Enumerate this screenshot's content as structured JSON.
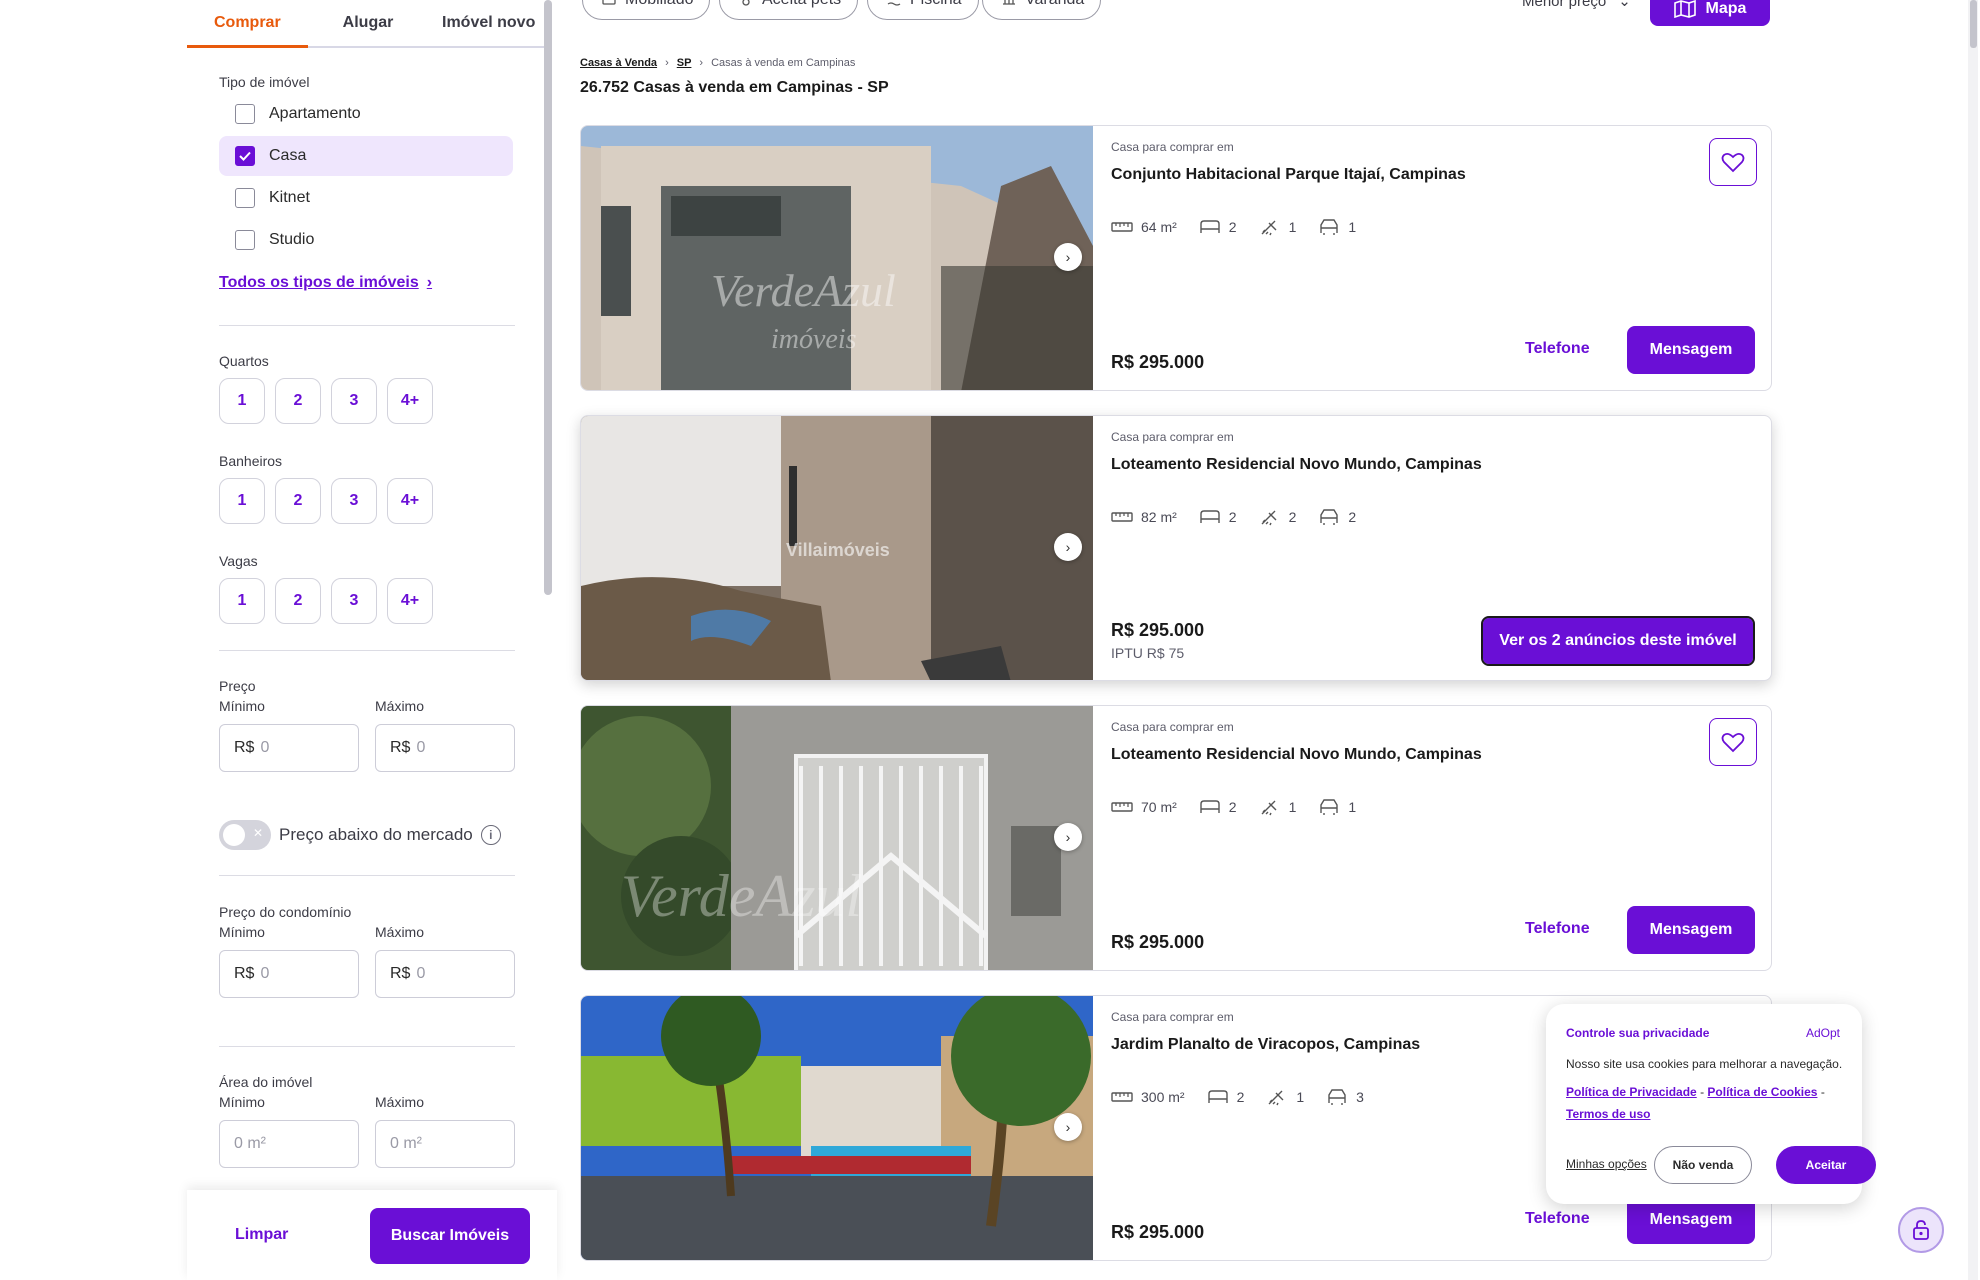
{
  "sidebar": {
    "tabs": [
      "Comprar",
      "Alugar",
      "Imóvel novo"
    ],
    "tipo_label": "Tipo de imóvel",
    "tipos": [
      "Apartamento",
      "Casa",
      "Kitnet",
      "Studio"
    ],
    "todos_link": "Todos os tipos de imóveis",
    "quartos_label": "Quartos",
    "banheiros_label": "Banheiros",
    "vagas_label": "Vagas",
    "options": [
      "1",
      "2",
      "3",
      "4+"
    ],
    "preco_label": "Preço",
    "minimo": "Mínimo",
    "maximo": "Máximo",
    "currency": "R$",
    "zero": "0",
    "area_zero": "0 m²",
    "abaixo_label": "Preço abaixo do mercado",
    "condominio_label": "Preço do condomínio",
    "area_label": "Área do imóvel",
    "limpar": "Limpar",
    "buscar": "Buscar Imóveis"
  },
  "toolbar": {
    "chips": [
      "Mobiliado",
      "Aceita pets",
      "Piscina",
      "Varanda"
    ],
    "sort": "Menor preço",
    "mapa": "Mapa"
  },
  "breadcrumb": [
    "Casas à Venda",
    "SP",
    "Casas à venda em Campinas"
  ],
  "results_title": "26.752 Casas à venda em Campinas - SP",
  "cards": [
    {
      "type": "Casa para comprar em",
      "address": "Conjunto Habitacional Parque Itajaí, Campinas",
      "area": "64 m²",
      "quartos": "2",
      "banheiros": "1",
      "vagas": "1",
      "price": "R$ 295.000",
      "telefone": "Telefone",
      "mensagem": "Mensagem",
      "watermark": "VerdeAzul Imóveis"
    },
    {
      "type": "Casa para comprar em",
      "address": "Loteamento Residencial Novo Mundo, Campinas",
      "area": "82 m²",
      "quartos": "2",
      "banheiros": "2",
      "vagas": "2",
      "price": "R$ 295.000",
      "iptu": "IPTU R$ 75",
      "ver": "Ver os 2 anúncios deste imóvel",
      "watermark": "Villaimóveis"
    },
    {
      "type": "Casa para comprar em",
      "address": "Loteamento Residencial Novo Mundo, Campinas",
      "area": "70 m²",
      "quartos": "2",
      "banheiros": "1",
      "vagas": "1",
      "price": "R$ 295.000",
      "telefone": "Telefone",
      "mensagem": "Mensagem",
      "watermark": "VerdeAzul"
    },
    {
      "type": "Casa para comprar em",
      "address": "Jardim Planalto de Viracopos, Campinas",
      "area": "300 m²",
      "quartos": "2",
      "banheiros": "1",
      "vagas": "3",
      "price": "R$ 295.000",
      "telefone": "Telefone",
      "mensagem": "Mensagem"
    }
  ],
  "cookie": {
    "title": "Controle sua privacidade",
    "brand": "AdOpt",
    "text": "Nosso site usa cookies para melhorar a navegação.",
    "link_privacidade": "Política de Privacidade",
    "link_cookies": "Política de Cookies",
    "link_termos": "Termos de uso",
    "sep": "-",
    "opcoes": "Minhas opções",
    "nao_venda": "Não venda",
    "aceitar": "Aceitar"
  },
  "colors": {
    "brand": "#6a0fd6",
    "tab_active": "#e85a0c"
  }
}
